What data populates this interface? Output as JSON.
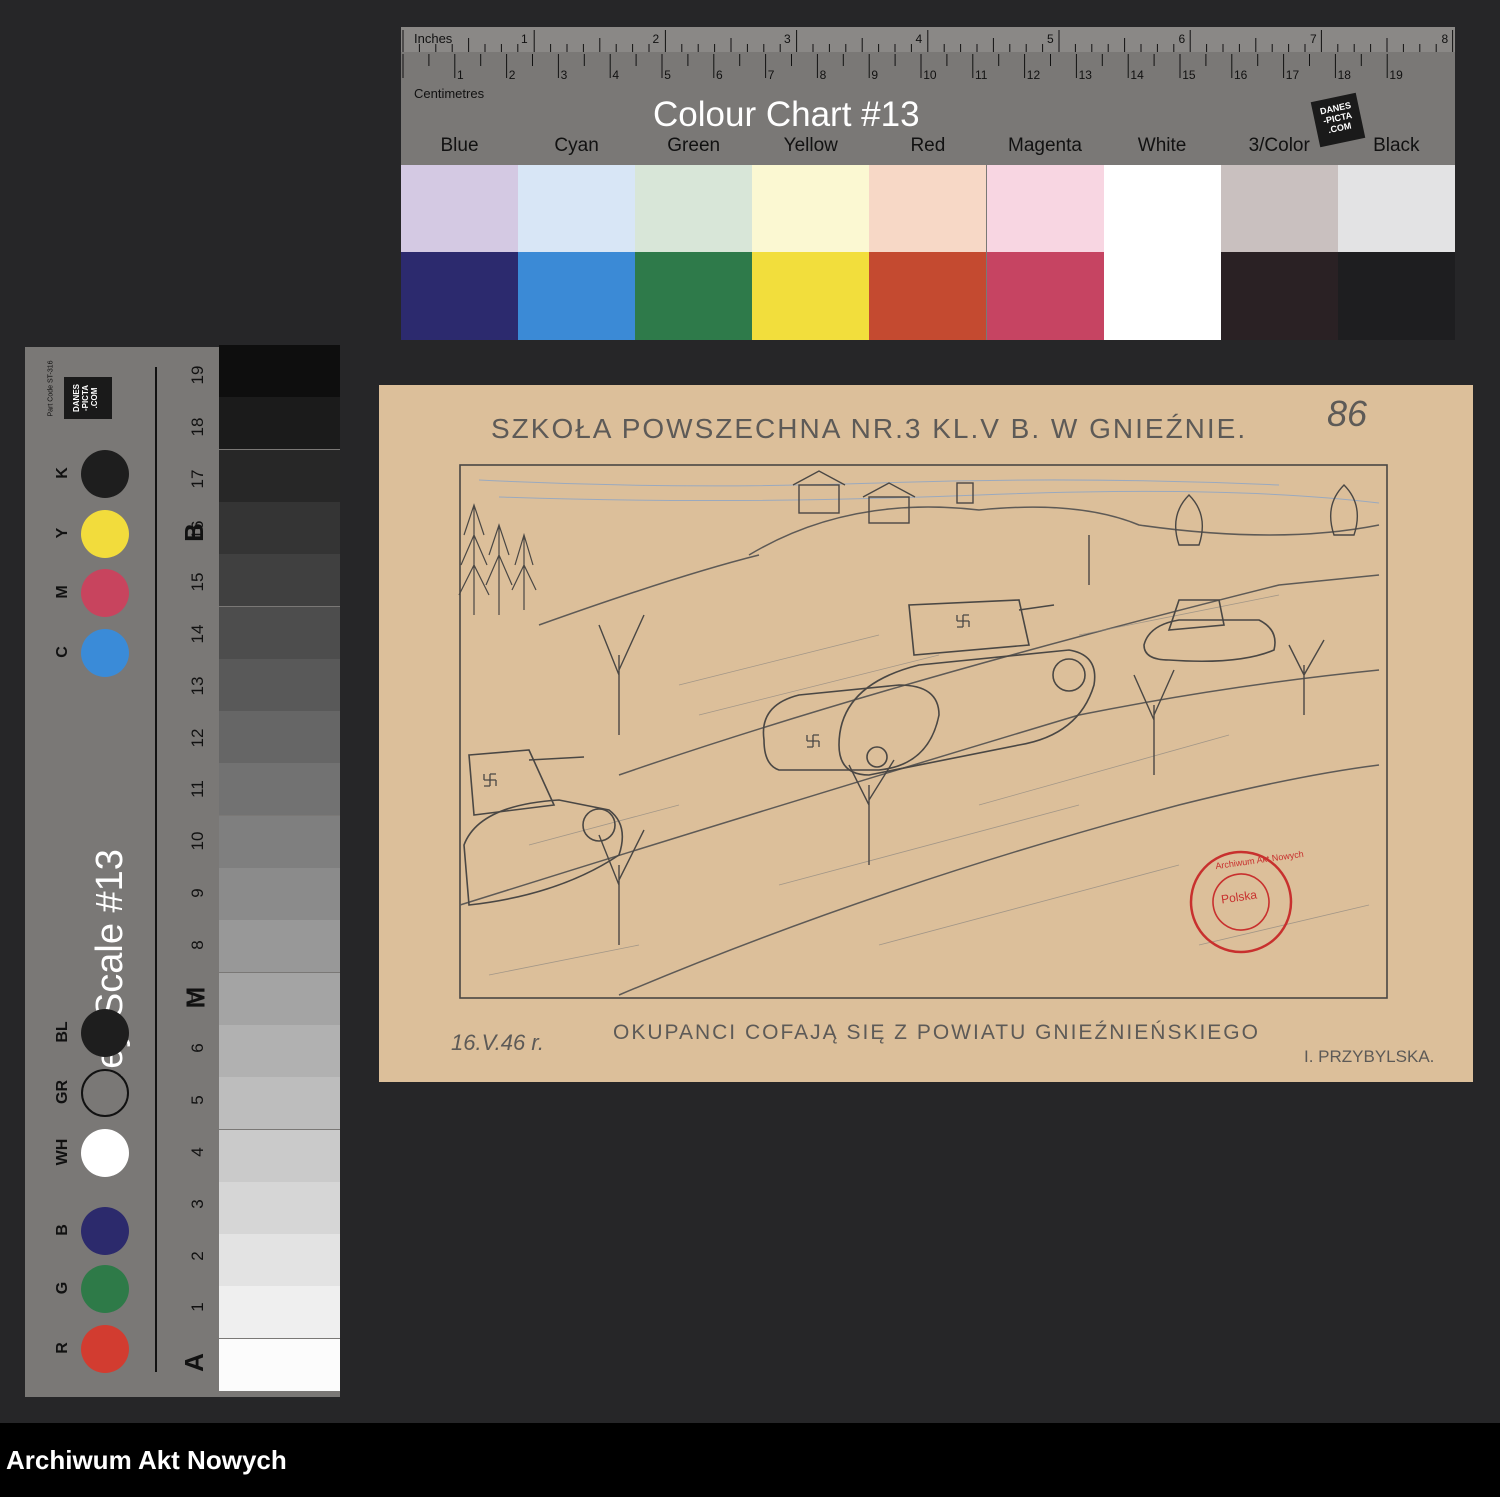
{
  "colour_chart": {
    "title": "Colour Chart #13",
    "inches_label": "Inches",
    "centimetres_label": "Centimetres",
    "inch_numbers": [
      "1",
      "2",
      "3",
      "4",
      "5",
      "6",
      "7",
      "8"
    ],
    "cm_numbers": [
      "1",
      "2",
      "3",
      "4",
      "5",
      "6",
      "7",
      "8",
      "9",
      "10",
      "11",
      "12",
      "13",
      "14",
      "15",
      "16",
      "17",
      "18",
      "19"
    ],
    "logo_text": "DANES-PICTA.COM",
    "swatches": [
      {
        "label": "Blue",
        "light": "#d4c9e3",
        "dark": "#2c2a6e"
      },
      {
        "label": "Cyan",
        "light": "#d8e6f6",
        "dark": "#3b8ad6"
      },
      {
        "label": "Green",
        "light": "#d8e6d8",
        "dark": "#2e7a4a"
      },
      {
        "label": "Yellow",
        "light": "#fbf8d2",
        "dark": "#f2de3c"
      },
      {
        "label": "Red",
        "light": "#f7d8c6",
        "dark": "#c44a30"
      },
      {
        "label": "Magenta",
        "light": "#f8d6e2",
        "dark": "#c64462"
      },
      {
        "label": "White",
        "light": "#ffffff",
        "dark": "#ffffff"
      },
      {
        "label": "3/Color",
        "light": "#c9c0bf",
        "dark": "#2a2124"
      },
      {
        "label": "Black",
        "light": "#e3e3e4",
        "dark": "#1e1e20"
      }
    ]
  },
  "grey_scale": {
    "title": "Grey Scale #13",
    "part_code": "Part Code ST-316",
    "logo_text": "DANES-PICTA.COM",
    "patches": [
      {
        "letter": "K",
        "color": "#1e1e1e"
      },
      {
        "letter": "Y",
        "color": "#f2dc3c"
      },
      {
        "letter": "M",
        "color": "#c8445e"
      },
      {
        "letter": "C",
        "color": "#3a8bd8"
      },
      {
        "letter": "BL",
        "color": "#1e1e1e"
      },
      {
        "letter": "GR",
        "color": "#7a7876"
      },
      {
        "letter": "WH",
        "color": "#ffffff"
      },
      {
        "letter": "B",
        "color": "#2c2a6c"
      },
      {
        "letter": "G",
        "color": "#2e7a48"
      },
      {
        "letter": "R",
        "color": "#d23c30"
      }
    ],
    "numbers": [
      "19",
      "18",
      "17",
      "16",
      "15",
      "14",
      "13",
      "12",
      "11",
      "10",
      "9",
      "8",
      "7",
      "6",
      "5",
      "4",
      "3",
      "2",
      "1"
    ],
    "markers": [
      "B",
      "M",
      "A"
    ]
  },
  "drawing": {
    "header": "SZKOŁA POWSZECHNA NR.3 KL.V B. W GNIEŹNIE.",
    "page_number": "86",
    "caption": "OKUPANCI COFAJĄ SIĘ Z POWIATU GNIEŹNIEŃSKIEGO",
    "date": "16.V.46 r.",
    "signature": "I. PRZYBYLSKA.",
    "stamp_text": "Archiwum Akt Nowych",
    "stamp_center": "Polska"
  },
  "footer": {
    "archive_name": "Archiwum Akt Nowych"
  }
}
